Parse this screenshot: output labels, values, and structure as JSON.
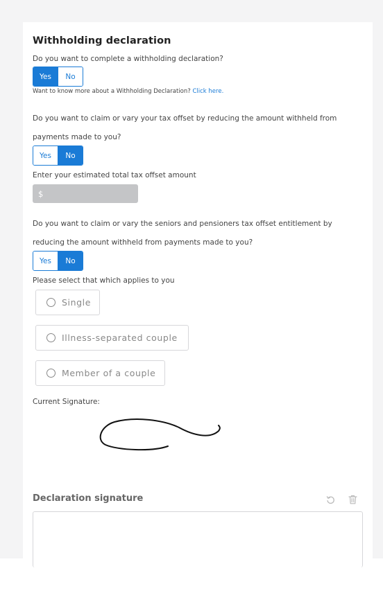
{
  "title": "Withholding declaration",
  "q1": {
    "text": "Do you want to complete a withholding declaration?",
    "yes": "Yes",
    "no": "No",
    "selected": "Yes",
    "help_text": "Want to know more about a Withholding Declaration?",
    "help_link": "Click here."
  },
  "q2": {
    "text_line1": "Do you want to claim or vary your tax offset by reducing the amount withheld from",
    "text_line2": "payments made to you?",
    "yes": "Yes",
    "no": "No",
    "selected": "No"
  },
  "tax_offset": {
    "label": "Enter your estimated total tax offset amount",
    "currency_symbol": "$",
    "value": ""
  },
  "q3": {
    "text_line1": "Do you want to claim or vary the seniors and pensioners tax offset entitlement by",
    "text_line2": "reducing the amount withheld from payments made to you?",
    "yes": "Yes",
    "no": "No",
    "selected": "No"
  },
  "applies": {
    "label": "Please select that which applies to you",
    "options": [
      "Single",
      "Illness-separated couple",
      "Member of a couple"
    ]
  },
  "current_signature": {
    "label": "Current Signature:"
  },
  "declaration_signature": {
    "title": "Declaration signature",
    "undo_icon": "undo-icon",
    "delete_icon": "trash-icon"
  },
  "colors": {
    "accent": "#1a7bd6",
    "disabled_input": "#c4c5c7"
  }
}
